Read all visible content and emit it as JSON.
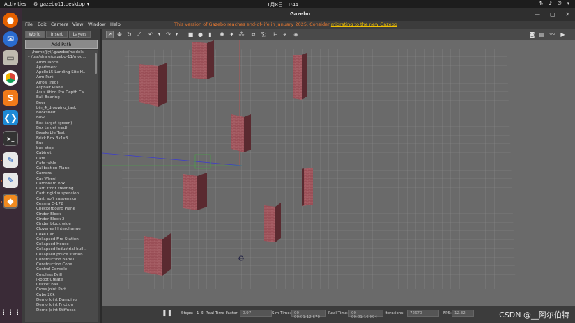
{
  "topbar": {
    "activities": "Activities",
    "app_name": "gazebo11.desktop",
    "clock": "1月8日  11:44"
  },
  "window": {
    "title": "Gazebo",
    "menu": [
      "File",
      "Edit",
      "Camera",
      "View",
      "Window",
      "Help"
    ],
    "notice_text": "This version of Gazebo reaches end-of-life in January 2025. Consider ",
    "notice_link": "migrating to the new Gazebo"
  },
  "left_panel": {
    "tabs": [
      "World",
      "Insert",
      "Layers"
    ],
    "add_path": "Add Path",
    "paths": [
      "/home/jiyi/.gazebo/models",
      "/usr/share/gazebo-11/mod..."
    ],
    "models": [
      "Ambulance",
      "Apartment",
      "Apollo15 Landing Site H...",
      "Arm Part",
      "Arrow (red)",
      "Asphalt Plane",
      "Asus Xtion Pro Depth Ca...",
      "Ball Bearing",
      "Beer",
      "bin_4_dropping_task",
      "Bookshelf",
      "Bowl",
      "Box target (green)",
      "Box target (red)",
      "Breakable Test",
      "Brick Box 3x1x3",
      "Bus",
      "bus_stop",
      "Cabinet",
      "Cafe",
      "Cafe table",
      "Calibration Plane",
      "Camera",
      "Car Wheel",
      "Cardboard box",
      "Cart: front steering",
      "Cart: rigid suspension",
      "Cart: soft suspension",
      "Cessna C-172",
      "Checkerboard Plane",
      "Cinder Block",
      "Cinder Block 2",
      "Cinder block wide",
      "Cloverleaf Interchange",
      "Coke Can",
      "Collapsed Fire Station",
      "Collapsed House",
      "Collapsed Industrial buil...",
      "Collapsed police station",
      "Construction Barrel",
      "Construction Cone",
      "Control Console",
      "Cordless Drill",
      "iRobot Create",
      "Cricket ball",
      "Cross Joint Part",
      "Cube 20k",
      "Demo Joint Damping",
      "Demo Joint Friction",
      "Demo Joint Stiffness"
    ]
  },
  "bottom": {
    "steps_label": "Steps:",
    "steps_value": "1",
    "rtf_label": "Real Time Factor:",
    "rtf_value": "0.97",
    "sim_label": "Sim Time:",
    "sim_value": "00 00:01:12.670",
    "real_label": "Real Time:",
    "real_value": "00 00:01:16.094",
    "iter_label": "Iterations:",
    "iter_value": "72670",
    "fps_label": "FPS:",
    "fps_value": "12.32",
    "watermark": "CSDN @__阿尔伯特"
  },
  "colors": {
    "grid_bg": "#6a6a6a",
    "brick": "#9a4f57",
    "accent_notice": "#e87830"
  }
}
